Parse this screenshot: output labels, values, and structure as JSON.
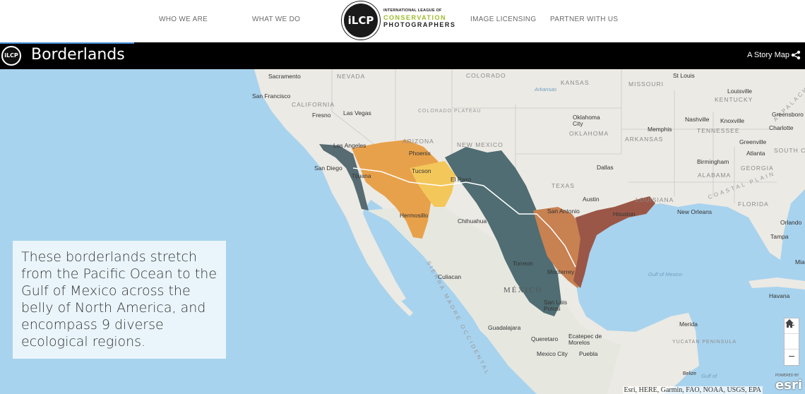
{
  "nav": {
    "items": [
      "WHO WE ARE",
      "WHAT WE DO",
      "IMAGE LICENSING",
      "PARTNER WITH US"
    ],
    "logo": {
      "mark": "iLCP",
      "line1": "INTERNATIONAL LEAGUE OF",
      "line2": "CONSERVATION",
      "line3": "PHOTOGRAPHERS"
    }
  },
  "storybar": {
    "logo_mark": "iLCP",
    "title": "Borderlands",
    "subtitle": "A Story Map",
    "share_icon": "share-icon"
  },
  "panel": {
    "text": "These borderlands stretch from the Pacific Ocean to the Gulf of Mexico across the belly of North America, and encompass 9 diverse ecological regions."
  },
  "map": {
    "cities": [
      "Sacramento",
      "San Francisco",
      "Fresno",
      "Las Vegas",
      "Los Angeles",
      "San Diego",
      "Tijuana",
      "Phoenix",
      "Tucson",
      "El Paso",
      "Hermosillo",
      "Chihuahua",
      "Culiacan",
      "Torreon",
      "Monterrey",
      "San Antonio",
      "Austin",
      "Houston",
      "Dallas",
      "Oklahoma City",
      "Memphis",
      "Nashville",
      "Knoxville",
      "St Louis",
      "Louisville",
      "Greenville",
      "Atlanta",
      "Charlotte",
      "Greensboro",
      "Birmingham",
      "New Orleans",
      "Orlando",
      "Tampa",
      "Miami",
      "Havana",
      "Merida",
      "Guadalajara",
      "Queretaro",
      "Mexico City",
      "Ecatepec de Morelos",
      "Puebla",
      "San Luis Potosi",
      "Belize"
    ],
    "states": [
      "NEVADA",
      "COLORADO",
      "KANSAS",
      "MISSOURI",
      "KENTUCKY",
      "CALIFORNIA",
      "TENNESSEE",
      "ARIZONA",
      "NEW MEXICO",
      "OKLAHOMA",
      "ARKANSAS",
      "TEXAS",
      "ALABAMA",
      "GEORGIA",
      "LOUISIANA",
      "FLORIDA",
      "SOUTH CAROLINA",
      "YUCATAN PENINSULA"
    ],
    "country": "MÉXICO",
    "features": [
      "COLORADO PLATEAU",
      "SIERRA MADRE OCCIDENTAL",
      "COASTAL PLAIN",
      "APPALACHIA"
    ],
    "water": [
      "Gulf of Mexico",
      "Arkansas",
      "Gulf of"
    ],
    "attribution": "Esri, HERE, Garmin, FAO, NOAA, USGS, EPA",
    "esri_logo": "esri",
    "esri_powered": "POWERED BY",
    "zoom": {
      "in": "+",
      "home": "home-icon",
      "out": "−"
    },
    "region_colors": [
      "#4e6a6f",
      "#e9a24a",
      "#f3c54f",
      "#4d6b72",
      "#c98252",
      "#9c5848"
    ]
  }
}
